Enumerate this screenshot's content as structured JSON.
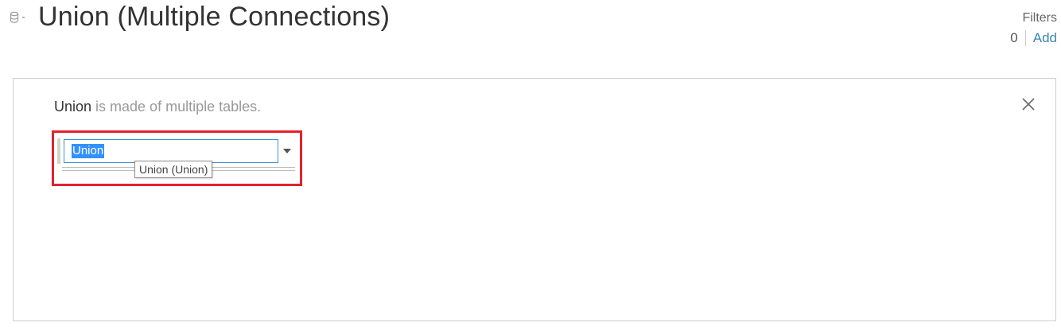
{
  "header": {
    "icon": "database-icon",
    "title": "Union (Multiple Connections)"
  },
  "filters": {
    "label": "Filters",
    "count": "0",
    "add_label": "Add",
    "add_color": "#3a87b0"
  },
  "panel": {
    "message_bold": "Union",
    "message_rest": " is made of multiple tables.",
    "close_icon": "close-icon",
    "table_name_value": "Union",
    "dropdown_icon": "caret-down-icon",
    "tooltip": "Union (Union)",
    "highlight_color": "#e3212d"
  }
}
